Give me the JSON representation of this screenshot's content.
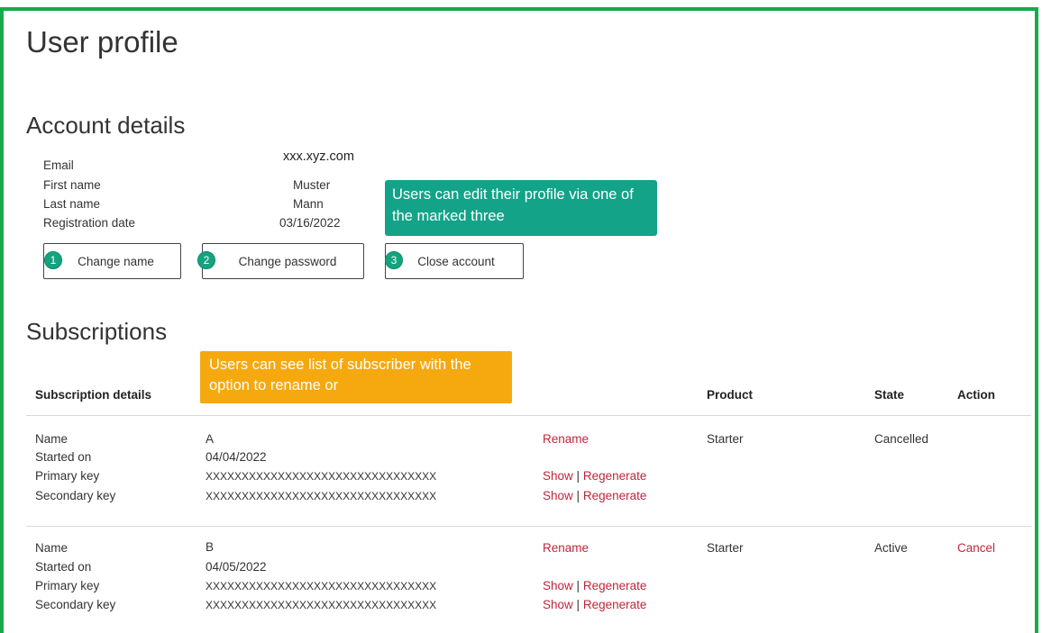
{
  "page_title": "User profile",
  "account": {
    "heading": "Account details",
    "email_label": "Email",
    "email_value": "xxx.xyz.com",
    "first_name_label": "First name",
    "first_name_value": "Muster",
    "last_name_label": "Last name",
    "last_name_value": "Mann",
    "reg_date_label": "Registration date",
    "reg_date_value": "03/16/2022"
  },
  "buttons": [
    {
      "badge": "1",
      "label": "Change name"
    },
    {
      "badge": "2",
      "label": "Change password"
    },
    {
      "badge": "3",
      "label": "Close account"
    }
  ],
  "callouts": {
    "edit_note": "Users can edit their profile via one of the marked three",
    "list_note": "Users can see list of subscriber with the option to rename or"
  },
  "subscriptions": {
    "heading": "Subscriptions",
    "columns": [
      "Subscription details",
      "Product",
      "State",
      "Action"
    ],
    "row_labels": [
      "Name",
      "Started on",
      "Primary key",
      "Secondary key"
    ],
    "rename_label": "Rename",
    "show_label": "Show",
    "separator": "|",
    "regenerate_label": "Regenerate",
    "rows": [
      {
        "name": "A",
        "started_on": "04/04/2022",
        "primary_key": "XXXXXXXXXXXXXXXXXXXXXXXXXXXXXXXX",
        "secondary_key": "XXXXXXXXXXXXXXXXXXXXXXXXXXXXXXXX",
        "product": "Starter",
        "state": "Cancelled",
        "action": ""
      },
      {
        "name": "B",
        "started_on": "04/05/2022",
        "primary_key": "XXXXXXXXXXXXXXXXXXXXXXXXXXXXXXXX",
        "secondary_key": "XXXXXXXXXXXXXXXXXXXXXXXXXXXXXXXX",
        "product": "Starter",
        "state": "Active",
        "action": "Cancel"
      }
    ]
  },
  "colors": {
    "frame": "#1aa84b",
    "badge": "#14a37f",
    "callout_green": "#12a388",
    "callout_orange": "#f5a90f",
    "link": "#c0263b"
  }
}
